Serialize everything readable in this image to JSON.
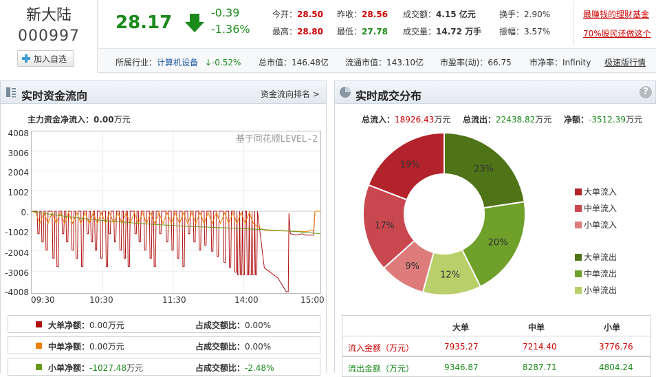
{
  "stock": {
    "name": "新大陆",
    "code": "000997",
    "add_label": "加入自选",
    "price": "28.17",
    "change": "-0.39",
    "change_pct": "-1.36%",
    "quotes": {
      "open_label": "今开：",
      "open": "28.50",
      "prev_close_label": "昨收：",
      "prev_close": "28.56",
      "amount_label": "成交额：",
      "amount": "4.15 亿元",
      "turnover_label": "换手：",
      "turnover": "2.90%",
      "high_label": "最高：",
      "high": "28.80",
      "low_label": "最低：",
      "low": "27.78",
      "volume_label": "成交量：",
      "volume": "14.72 万手",
      "amplitude_label": "振幅：",
      "amplitude": "3.57%"
    },
    "promo": [
      "最赚钱的理财基金",
      "70%股民还做这个"
    ]
  },
  "row2": {
    "industry_label": "所属行业：",
    "industry": "计算机设备",
    "industry_change": "↓-0.52%",
    "mktcap": "总市值：146.48亿",
    "float_cap": "流通市值：143.10亿",
    "pe": "市盈率(动)：66.75",
    "pb": "市净率：Infinity",
    "fast_link": "极速版行情"
  },
  "left_panel": {
    "title": "实时资金流向",
    "rank_link": "资金流向排名 >",
    "net_inflow_label": "主力资金净流入：",
    "net_inflow_value": "0.00",
    "net_inflow_unit": "万元",
    "watermark": "基于同花顺LEVEL-2",
    "y_ticks": [
      "4008",
      "3006",
      "2004",
      "1002",
      "0.",
      "-1002",
      "-2004",
      "-3006",
      "-4008"
    ],
    "x_ticks": [
      "09:30",
      "10:30",
      "11:30",
      "14:00",
      "15:00"
    ],
    "stats": [
      {
        "label": "大单净额：",
        "value": "0.00",
        "unit": "万元",
        "ratio_label": "占成交额比：",
        "ratio": "0.00%",
        "color": "#b01010"
      },
      {
        "label": "中单净额：",
        "value": "0.00",
        "unit": "万元",
        "ratio_label": "占成交额比：",
        "ratio": "0.00%",
        "color": "#f08000"
      },
      {
        "label": "小单净额：",
        "value": "-1027.48",
        "unit": "万元",
        "ratio_label": "占成交额比：",
        "ratio": "-2.48%",
        "color": "#6a9a1a"
      }
    ]
  },
  "right_panel": {
    "title": "实时成交分布",
    "help": "?",
    "inflow_label": "总流入：",
    "inflow": "18926.43",
    "inflow_unit": "万元",
    "outflow_label": "总流出：",
    "outflow": "22438.82",
    "outflow_unit": "万元",
    "net_label": "净额：",
    "net": "-3512.39",
    "net_unit": "万元",
    "legend": [
      {
        "label": "大单流入",
        "color": "#b3232b"
      },
      {
        "label": "中单流入",
        "color": "#c9474e"
      },
      {
        "label": "小单流入",
        "color": "#de7c7c"
      },
      {
        "label": "大单流出",
        "color": "#4e7417"
      },
      {
        "label": "中单流出",
        "color": "#6fa02a"
      },
      {
        "label": "小单流出",
        "color": "#b8cf6a"
      }
    ],
    "table": {
      "headers": [
        "大单",
        "中单",
        "小单"
      ],
      "rows": [
        {
          "label": "流入金额（万元）",
          "values": [
            "7935.27",
            "7214.40",
            "3776.76"
          ]
        },
        {
          "label": "流出金额（万元）",
          "values": [
            "9346.87",
            "8287.71",
            "4804.24"
          ]
        }
      ]
    }
  },
  "chart_data": [
    {
      "type": "pie",
      "title": "",
      "labels": [
        "大单流出",
        "中单流出",
        "小单流出",
        "小单流入",
        "中单流入",
        "大单流入"
      ],
      "values": [
        9346.87,
        8287.71,
        4804.24,
        3776.76,
        7214.4,
        7935.27
      ],
      "percent_labels": [
        "23%",
        "20%",
        "12%",
        "9%",
        "17%",
        "19%"
      ],
      "colors": [
        "#4e7417",
        "#6fa02a",
        "#b8cf6a",
        "#de7c7c",
        "#c9474e",
        "#b3232b"
      ],
      "legend_position": "right"
    },
    {
      "type": "line",
      "title": "",
      "x": [
        "09:30",
        "10:30",
        "11:30",
        "14:00",
        "15:00"
      ],
      "series": [],
      "ylim": [
        -4008,
        4008
      ],
      "grid": true
    }
  ]
}
